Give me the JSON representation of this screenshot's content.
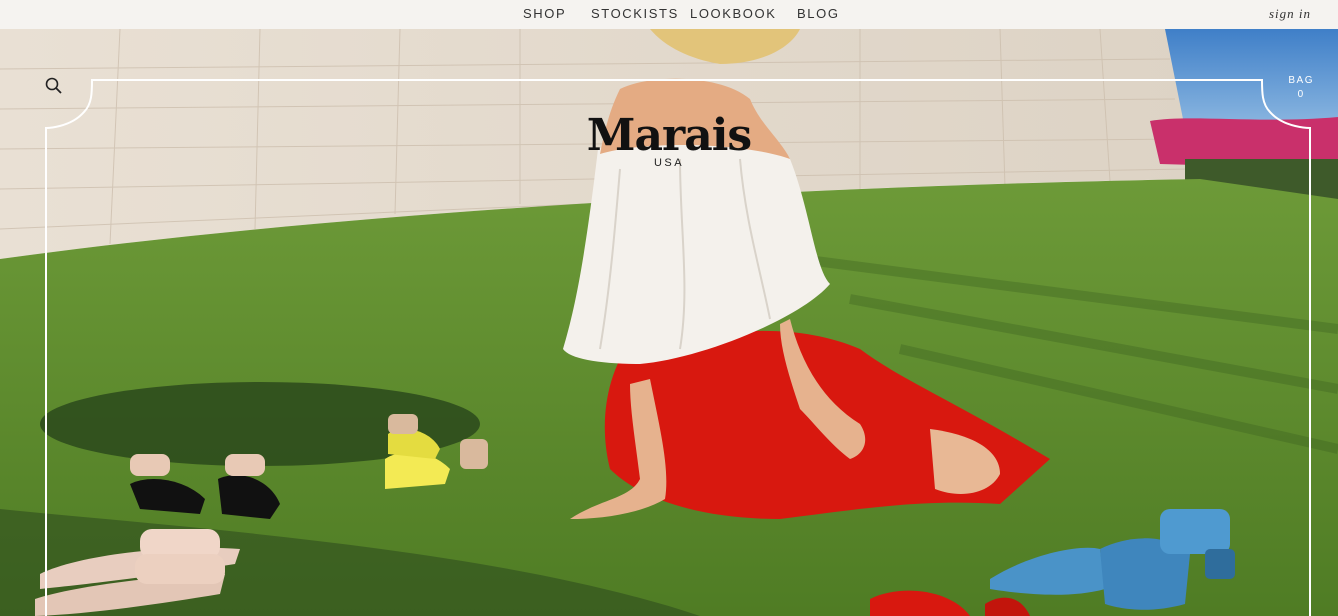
{
  "nav": {
    "items": [
      {
        "label": "SHOP"
      },
      {
        "label": "STOCKISTS"
      },
      {
        "label": "LOOKBOOK"
      },
      {
        "label": "BLOG"
      }
    ],
    "signin": "sign in"
  },
  "brand": {
    "name": "Marais",
    "sub": "USA"
  },
  "bag": {
    "label": "BAG",
    "count": "0"
  },
  "icons": {
    "search": "search-icon"
  },
  "colors": {
    "nav_bg": "#f5f3f0",
    "grass": "#5f8a2e",
    "dress_red": "#d8180f",
    "top_white": "#f4f1ec"
  }
}
